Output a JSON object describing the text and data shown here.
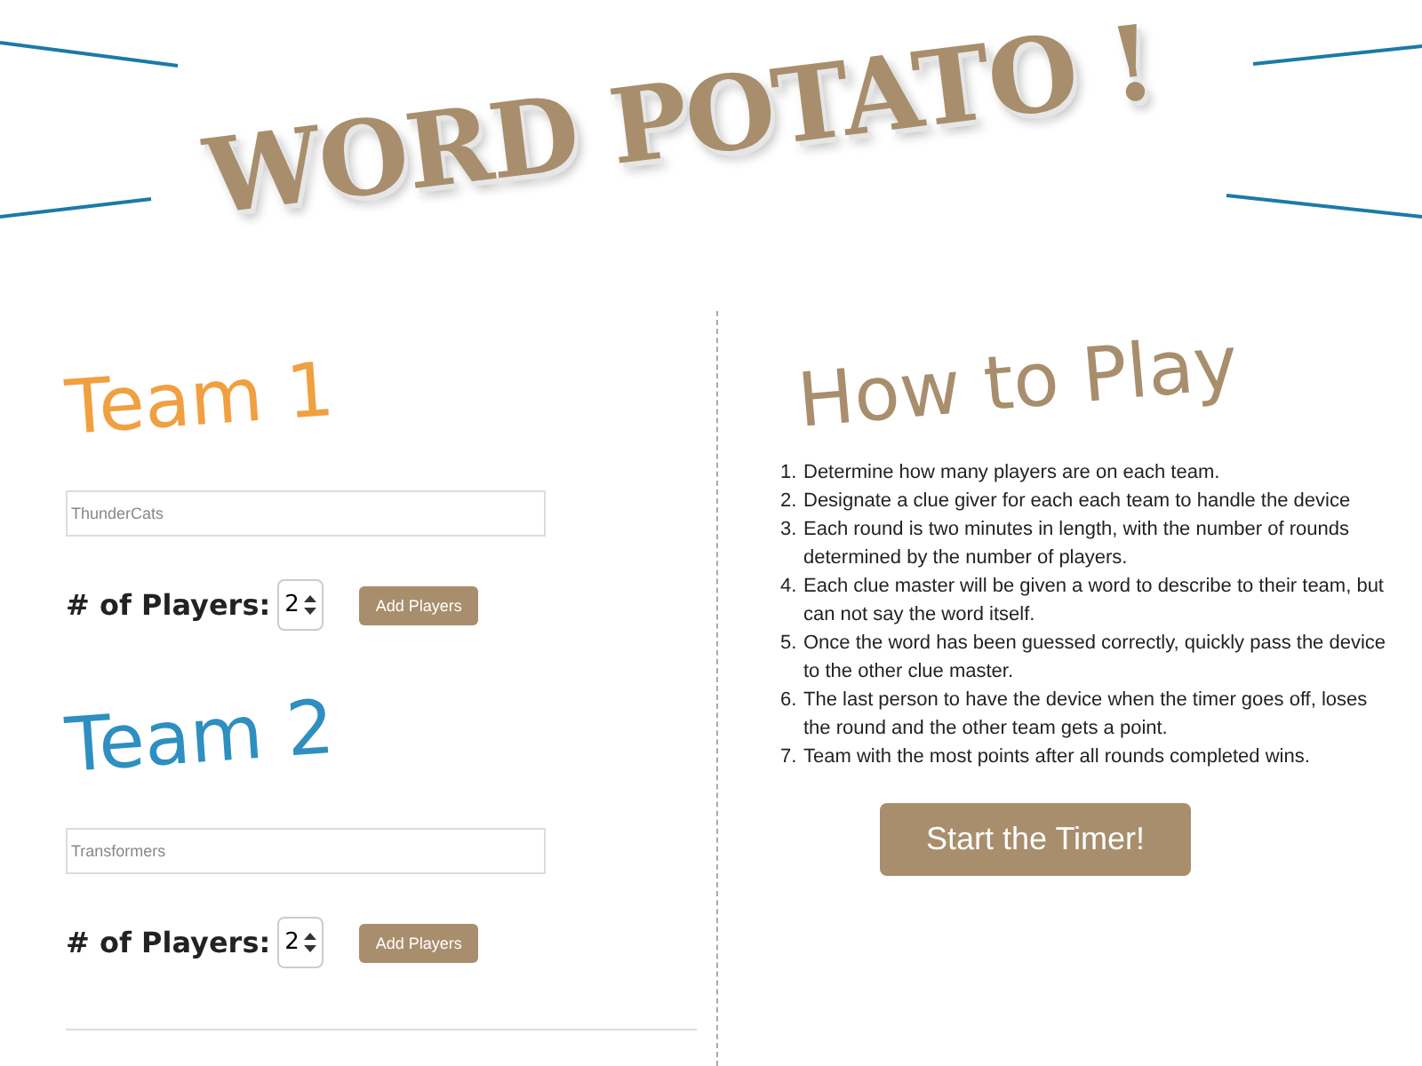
{
  "title": "WORD POTATO !",
  "teams": [
    {
      "name": "Team 1",
      "color": "#f0a040",
      "placeholder": "ThunderCats",
      "players_label": "# of Players:",
      "players": "2",
      "button": "Add Players"
    },
    {
      "name": "Team 2",
      "color": "#2e8fc0",
      "placeholder": "Transformers",
      "players_label": "# of Players:",
      "players": "2",
      "button": "Add Players"
    }
  ],
  "how_to_play": {
    "heading": "How to Play",
    "steps": [
      {
        "number": "1.",
        "text": "Determine how many players are on each team."
      },
      {
        "number": "2.",
        "text": "Designate a clue giver for each each team to handle the device"
      },
      {
        "number": "3.",
        "text": "Each round is two minutes in length, with the number of rounds determined by the number of players."
      },
      {
        "number": "4.",
        "text": "Each clue master will be given a word to describe to their team, but can not say the word itself."
      },
      {
        "number": "5.",
        "text": "Once the word has been guessed correctly, quickly pass the device to the other clue master."
      },
      {
        "number": "6.",
        "text": "The last person to have the device when the timer goes off, loses the round and the other team gets a point."
      },
      {
        "number": "7.",
        "text": "Team with the most points after all rounds completed wins."
      }
    ],
    "button": "Start the Timer!"
  }
}
